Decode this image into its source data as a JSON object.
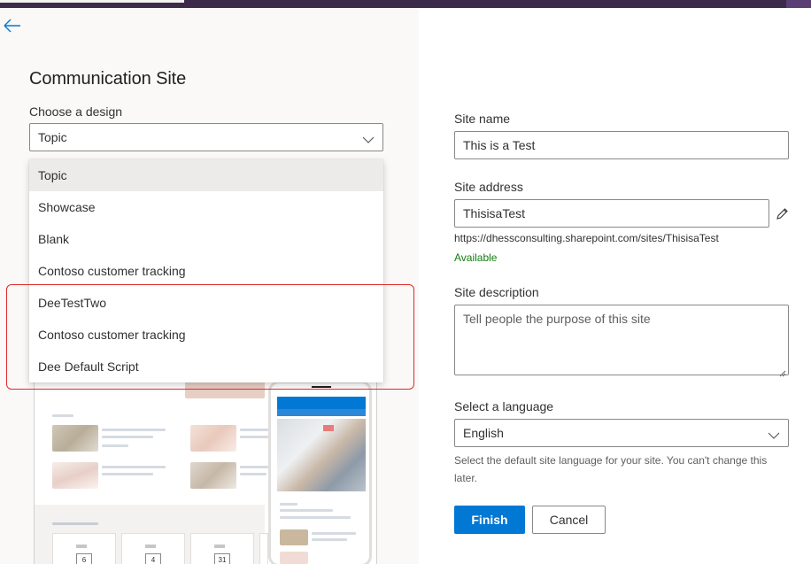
{
  "header": {
    "title": "Communication Site"
  },
  "design": {
    "label": "Choose a design",
    "selected": "Topic",
    "options": [
      "Topic",
      "Showcase",
      "Blank",
      "Contoso customer tracking",
      "DeeTestTwo",
      "Contoso customer tracking",
      "Dee Default Script"
    ]
  },
  "preview": {
    "calendar_days": [
      "6",
      "4",
      "31"
    ]
  },
  "site_name": {
    "label": "Site name",
    "value": "This is a Test"
  },
  "site_address": {
    "label": "Site address",
    "value": "ThisisaTest",
    "url": "https://dhessconsulting.sharepoint.com/sites/ThisisaTest",
    "status": "Available"
  },
  "site_description": {
    "label": "Site description",
    "placeholder": "Tell people the purpose of this site"
  },
  "language": {
    "label": "Select a language",
    "value": "English",
    "hint": "Select the default site language for your site. You can't change this later."
  },
  "actions": {
    "finish": "Finish",
    "cancel": "Cancel"
  },
  "colors": {
    "accent": "#0078d4",
    "available": "#107c10",
    "highlight": "#e22828"
  }
}
